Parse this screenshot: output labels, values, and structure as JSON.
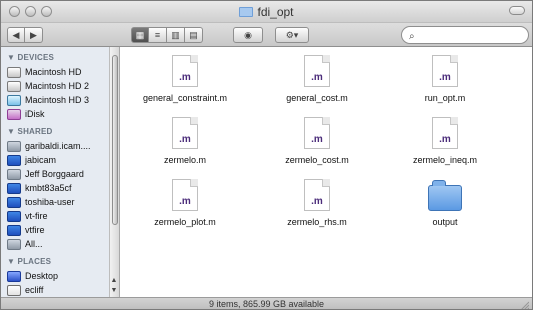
{
  "window": {
    "title": "fdi_opt",
    "status": "9 items, 865.99 GB available"
  },
  "toolbar": {
    "search_placeholder": ""
  },
  "sidebar": {
    "sections": {
      "devices": "▼ DEVICES",
      "shared": "▼ SHARED",
      "places": "▼ PLACES"
    },
    "devices": [
      "Macintosh HD",
      "Macintosh HD 2",
      "Macintosh HD 3",
      "iDisk"
    ],
    "shared": [
      "garibaldi.icam....",
      "jabicam",
      "Jeff Borggaard",
      "kmbt83a5cf",
      "toshiba-user",
      "vt-fire",
      "vtfire",
      "All..."
    ],
    "places": [
      "Desktop",
      "ecliff"
    ]
  },
  "files": [
    {
      "name": "general_constraint.m",
      "ext": ".m",
      "kind": "doc"
    },
    {
      "name": "general_cost.m",
      "ext": ".m",
      "kind": "doc"
    },
    {
      "name": "run_opt.m",
      "ext": ".m",
      "kind": "doc"
    },
    {
      "name": "zermelo.m",
      "ext": ".m",
      "kind": "doc"
    },
    {
      "name": "zermelo_cost.m",
      "ext": ".m",
      "kind": "doc"
    },
    {
      "name": "zermelo_ineq.m",
      "ext": ".m",
      "kind": "doc"
    },
    {
      "name": "zermelo_plot.m",
      "ext": ".m",
      "kind": "doc"
    },
    {
      "name": "zermelo_rhs.m",
      "ext": ".m",
      "kind": "doc"
    },
    {
      "name": "output",
      "ext": "",
      "kind": "folder"
    }
  ]
}
